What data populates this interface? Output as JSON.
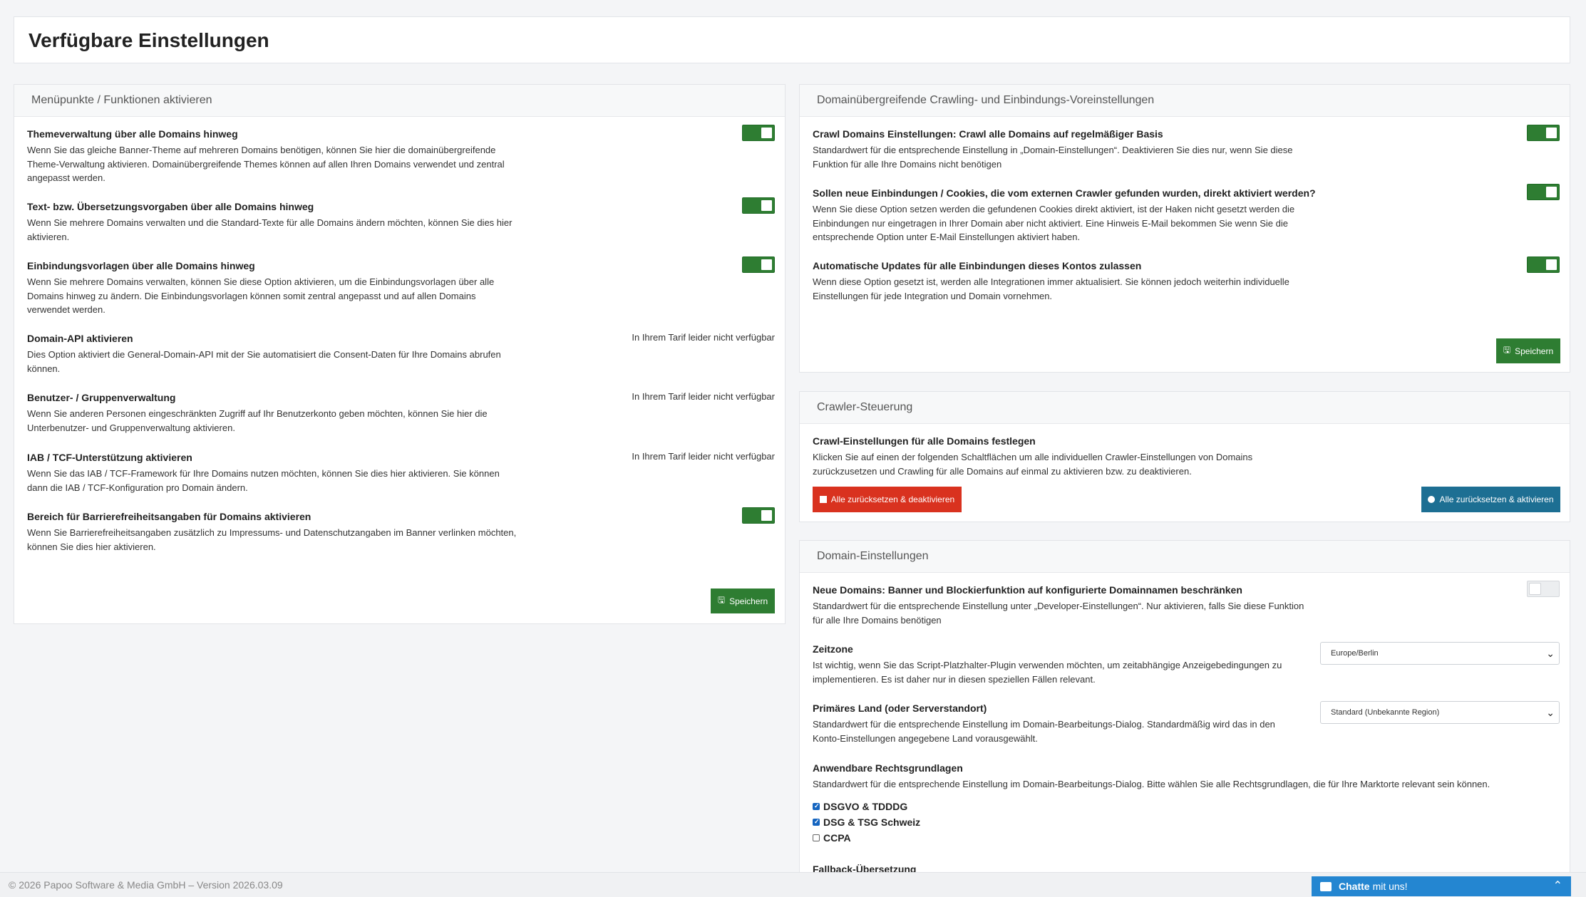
{
  "page_title": "Verfügbare Einstellungen",
  "left_panel": {
    "title": "Menüpunkte / Funktionen aktivieren",
    "items": [
      {
        "title": "Themeverwaltung über alle Domains hinweg",
        "desc": "Wenn Sie das gleiche Banner-Theme auf mehreren Domains benötigen, können Sie hier die domainübergreifende Theme-Verwaltung aktivieren. Domainübergreifende Themes können auf allen Ihren Domains verwendet und zentral angepasst werden.",
        "state": "on"
      },
      {
        "title": "Text- bzw. Übersetzungsvorgaben über alle Domains hinweg",
        "desc": "Wenn Sie mehrere Domains verwalten und die Standard-Texte für alle Domains ändern möchten, können Sie dies hier aktivieren.",
        "state": "on"
      },
      {
        "title": "Einbindungsvorlagen über alle Domains hinweg",
        "desc": "Wenn Sie mehrere Domains verwalten, können Sie diese Option aktivieren, um die Einbindungsvorlagen über alle Domains hinweg zu ändern. Die Einbindungsvorlagen können somit zentral angepasst und auf allen Domains verwendet werden.",
        "state": "on"
      },
      {
        "title": "Domain-API aktivieren",
        "desc": "Dies Option aktiviert die General-Domain-API mit der Sie automatisiert die Consent-Daten für Ihre Domains abrufen können.",
        "unavailable": "In Ihrem Tarif leider nicht verfügbar"
      },
      {
        "title": "Benutzer- / Gruppenverwaltung",
        "desc": "Wenn Sie anderen Personen eingeschränkten Zugriff auf Ihr Benutzerkonto geben möchten, können Sie hier die Unterbenutzer- und Gruppenverwaltung aktivieren.",
        "unavailable": "In Ihrem Tarif leider nicht verfügbar"
      },
      {
        "title": "IAB / TCF-Unterstützung aktivieren",
        "desc": "Wenn Sie das IAB / TCF-Framework für Ihre Domains nutzen möchten, können Sie dies hier aktivieren. Sie können dann die IAB / TCF-Konfiguration pro Domain ändern.",
        "unavailable": "In Ihrem Tarif leider nicht verfügbar"
      },
      {
        "title": "Bereich für Barrierefreiheitsangaben für Domains aktivieren",
        "desc": "Wenn Sie Barrierefreiheitsangaben zusätzlich zu Impressums- und Datenschutzangaben im Banner verlinken möchten, können Sie dies hier aktivieren.",
        "state": "on"
      }
    ],
    "save_label": "Speichern"
  },
  "crawl_panel": {
    "title": "Domainübergreifende Crawling- und Einbindungs-Voreinstellungen",
    "items": [
      {
        "title": "Crawl Domains Einstellungen: Crawl alle Domains auf regelmäßiger Basis",
        "desc": "Standardwert für die entsprechende Einstellung in „Domain-Einstellungen“. Deaktivieren Sie dies nur, wenn Sie diese Funktion für alle Ihre Domains nicht benötigen",
        "state": "on"
      },
      {
        "title": "Sollen neue Einbindungen / Cookies, die vom externen Crawler gefunden wurden, direkt aktiviert werden?",
        "desc": "Wenn Sie diese Option setzen werden die gefundenen Cookies direkt aktiviert, ist der Haken nicht gesetzt werden die Einbindungen nur eingetragen in Ihrer Domain aber nicht aktiviert. Eine Hinweis E-Mail bekommen Sie wenn Sie die entsprechende Option unter E-Mail Einstellungen aktiviert haben.",
        "state": "on"
      },
      {
        "title": "Automatische Updates für alle Einbindungen dieses Kontos zulassen",
        "desc": "Wenn diese Option gesetzt ist, werden alle Integrationen immer aktualisiert. Sie können jedoch weiterhin individuelle Einstellungen für jede Integration und Domain vornehmen.",
        "state": "on"
      }
    ],
    "save_label": "Speichern"
  },
  "crawler_panel": {
    "title": "Crawler-Steuerung",
    "item_title": "Crawl-Einstellungen für alle Domains festlegen",
    "item_desc": "Klicken Sie auf einen der folgenden Schaltflächen um alle individuellen Crawler-Einstellungen von Domains zurückzusetzen und Crawling für alle Domains auf einmal zu aktivieren bzw. zu deaktivieren.",
    "reset_deactivate_label": "Alle zurücksetzen & deaktivieren",
    "reset_activate_label": "Alle zurücksetzen & aktivieren"
  },
  "domain_panel": {
    "title": "Domain-Einstellungen",
    "restrict_title": "Neue Domains: Banner und Blockierfunktion auf konfigurierte Domainnamen beschränken",
    "restrict_desc": "Standardwert für die entsprechende Einstellung unter „Developer-Einstellungen“. Nur aktivieren, falls Sie diese Funktion für alle Ihre Domains benötigen",
    "restrict_state": "off",
    "timezone_title": "Zeitzone",
    "timezone_desc": "Ist wichtig, wenn Sie das Script-Platzhalter-Plugin verwenden möchten, um zeitabhängige Anzeigebedingungen zu implementieren. Es ist daher nur in diesen speziellen Fällen relevant.",
    "timezone_value": "Europe/Berlin",
    "country_title": "Primäres Land (oder Serverstandort)",
    "country_desc": "Standardwert für die entsprechende Einstellung im Domain-Bearbeitungs-Dialog. Standardmäßig wird das in den Konto-Einstellungen angegebene Land vorausgewählt.",
    "country_value": "Standard (Unbekannte Region)",
    "legal_title": "Anwendbare Rechtsgrundlagen",
    "legal_desc": "Standardwert für die entsprechende Einstellung im Domain-Bearbeitungs-Dialog. Bitte wählen Sie alle Rechtsgrundlagen, die für Ihre Marktorte relevant sein können.",
    "legal_options": [
      {
        "label": "DSGVO & TDDDG",
        "checked": true
      },
      {
        "label": "DSG & TSG Schweiz",
        "checked": true
      },
      {
        "label": "CCPA",
        "checked": false
      }
    ],
    "fallback_title": "Fallback-Übersetzung"
  },
  "footer": {
    "text": "© 2026 Papoo Software & Media GmbH – Version 2026.03.09"
  },
  "chat": {
    "label_bold": "Chatte",
    "label_rest": "mit uns!"
  },
  "colors": {
    "accent_green": "#2e7d32",
    "danger_red": "#d9321f",
    "info_blue": "#1d6f93",
    "chat_blue": "#2486d1"
  }
}
